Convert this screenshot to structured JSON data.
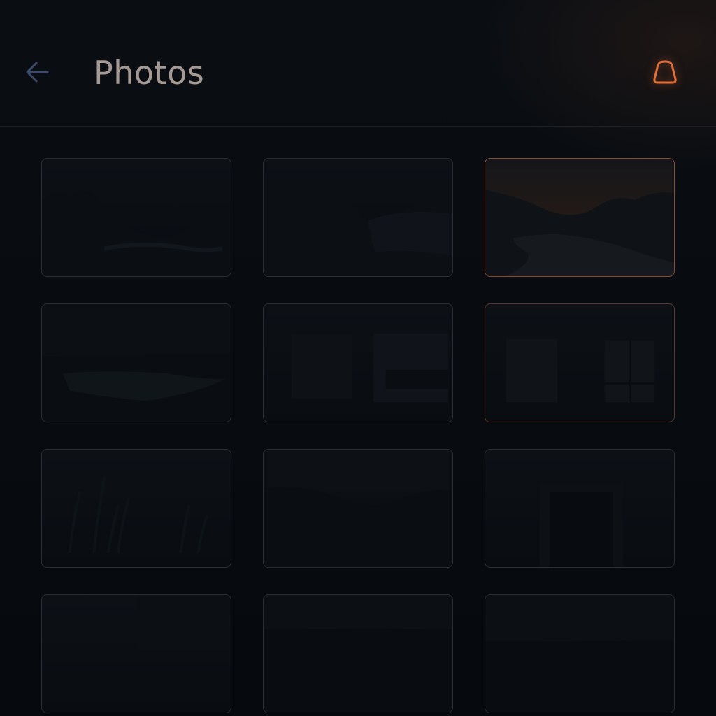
{
  "header": {
    "title": "Photos",
    "back_icon": "arrow-left-icon",
    "action_icon": "bell-outline-icon"
  },
  "colors": {
    "background": "#070b10",
    "title_text": "#a59a93",
    "back_icon": "#3a4a6a",
    "accent": "#e0703a",
    "tile_border": "#2a2f36",
    "divider": "#1c2128"
  },
  "photos": [
    {
      "subject": "dark-forest-landscape"
    },
    {
      "subject": "dark-valley-hills"
    },
    {
      "subject": "dusk-mountains-river"
    },
    {
      "subject": "dark-lake-horizon"
    },
    {
      "subject": "dark-interior-windows"
    },
    {
      "subject": "dark-room-window"
    },
    {
      "subject": "dark-grass-reeds"
    },
    {
      "subject": "dark-rolling-hills"
    },
    {
      "subject": "dark-doorway"
    },
    {
      "subject": "dark-abstract"
    },
    {
      "subject": "dark-horizon-field"
    },
    {
      "subject": "dark-plain"
    }
  ]
}
